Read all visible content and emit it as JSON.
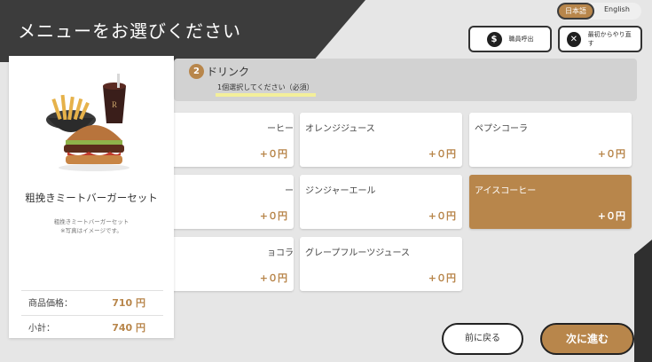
{
  "header": {
    "title": "メニューをお選びください"
  },
  "language": {
    "japanese": "日本語",
    "english": "English"
  },
  "actions": {
    "staff_call": "職員呼出",
    "restart": "最初からやり直す"
  },
  "step": {
    "number": "2",
    "title": "ドリンク",
    "note": "1個選択してください（必須）"
  },
  "product": {
    "name": "粗挽きミートバーガーセット",
    "desc_line1": "粗挽きミートバーガーセット",
    "desc_line2": "※写真はイメージです。",
    "base_price_label": "商品価格：",
    "base_price": "710 円",
    "subtotal_label": "小計：",
    "subtotal": "740 円"
  },
  "drinks": [
    {
      "name": "ーヒー",
      "price": "+０円"
    },
    {
      "name": "オレンジジュース",
      "price": "+０円"
    },
    {
      "name": "ペプシコーラ",
      "price": "+０円"
    },
    {
      "name": "ー",
      "price": "+０円"
    },
    {
      "name": "ジンジャーエール",
      "price": "+０円"
    },
    {
      "name": "アイスコーヒー",
      "price": "+０円",
      "selected": true
    },
    {
      "name": "ョコラ",
      "price": "+０円"
    },
    {
      "name": "グレープフルーツジュース",
      "price": "+０円"
    }
  ],
  "nav": {
    "back": "前に戻る",
    "next": "次に進む"
  },
  "colors": {
    "accent": "#b8864b",
    "header": "#3c3c3c",
    "background": "#e6e6e6",
    "highlight": "#f3ef9a"
  }
}
